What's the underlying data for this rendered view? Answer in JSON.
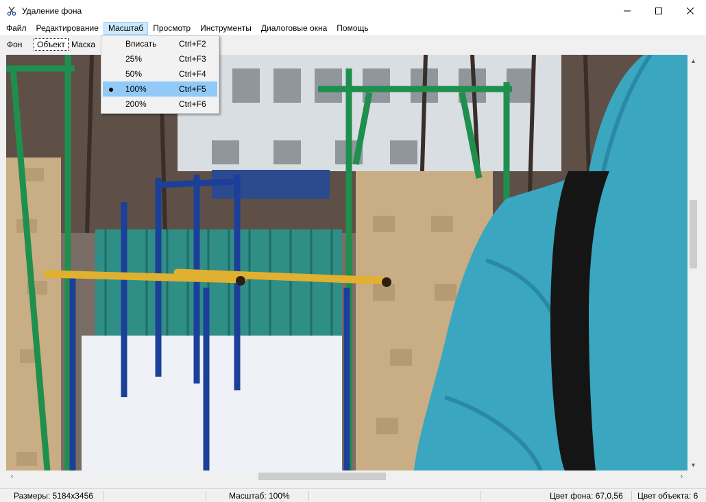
{
  "window": {
    "title": "Удаление фона",
    "controls": [
      "minimize-icon",
      "maximize-icon",
      "close-icon"
    ]
  },
  "menubar": {
    "items": [
      {
        "label": "Файл"
      },
      {
        "label": "Редактирование"
      },
      {
        "label": "Масштаб",
        "open": true
      },
      {
        "label": "Просмотр"
      },
      {
        "label": "Инструменты"
      },
      {
        "label": "Диалоговые окна"
      },
      {
        "label": "Помощь"
      }
    ]
  },
  "tabs": [
    {
      "label": "Фон"
    },
    {
      "label": "Объект",
      "active": true
    },
    {
      "label": "Маска"
    }
  ],
  "zoom_menu": {
    "items": [
      {
        "label": "Вписать",
        "shortcut": "Ctrl+F2"
      },
      {
        "label": "25%",
        "shortcut": "Ctrl+F3"
      },
      {
        "label": "50%",
        "shortcut": "Ctrl+F4"
      },
      {
        "label": "100%",
        "shortcut": "Ctrl+F5",
        "selected": true
      },
      {
        "label": "200%",
        "shortcut": "Ctrl+F6"
      }
    ]
  },
  "statusbar": {
    "size": "Размеры: 5184x3456",
    "zoom": "Масштаб: 100%",
    "bg_color": "Цвет фона: 67,0,56",
    "obj_color": "Цвет объекта: 6"
  },
  "scrollbars": {
    "vertical_position": 0.35,
    "horizontal_position": 0.38
  },
  "colors": {
    "selection": "#91c9f7",
    "menu_open": "#cce8ff",
    "jacket": "#3aa6c0",
    "green_bars": "#1f8f4e",
    "blue_bars": "#1c3f9a",
    "yellow_bar": "#e0b030"
  }
}
